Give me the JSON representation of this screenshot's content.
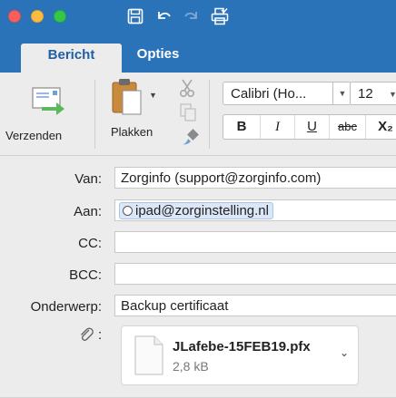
{
  "window": {
    "tabs": [
      {
        "label": "Bericht",
        "active": true
      },
      {
        "label": "Opties",
        "active": false
      }
    ],
    "toolbar_icons": [
      "save-icon",
      "undo-icon",
      "redo-icon",
      "print-icon"
    ]
  },
  "ribbon": {
    "send_label": "Verzenden",
    "paste_label": "Plakken",
    "font_name": "Calibri (Ho...",
    "font_size": "12",
    "format_buttons": {
      "bold": "B",
      "italic": "I",
      "underline": "U",
      "strike": "abc",
      "subscript": "X₂"
    }
  },
  "compose": {
    "from_label": "Van:",
    "from_value": "Zorginfo (support@zorginfo.com)",
    "to_label": "Aan:",
    "to_recipient": "ipad@zorginstelling.nl",
    "cc_label": "CC:",
    "cc_value": "",
    "bcc_label": "BCC:",
    "bcc_value": "",
    "subject_label": "Onderwerp:",
    "subject_value": "Backup certificaat",
    "attachment_label_suffix": ":",
    "attachment": {
      "file_name": "JLafebe-15FEB19.pfx",
      "file_size": "2,8 kB"
    }
  },
  "colors": {
    "titlebar": "#2b73b8",
    "accent_text": "#1f5fa6",
    "send_arrow": "#5cb85c"
  }
}
